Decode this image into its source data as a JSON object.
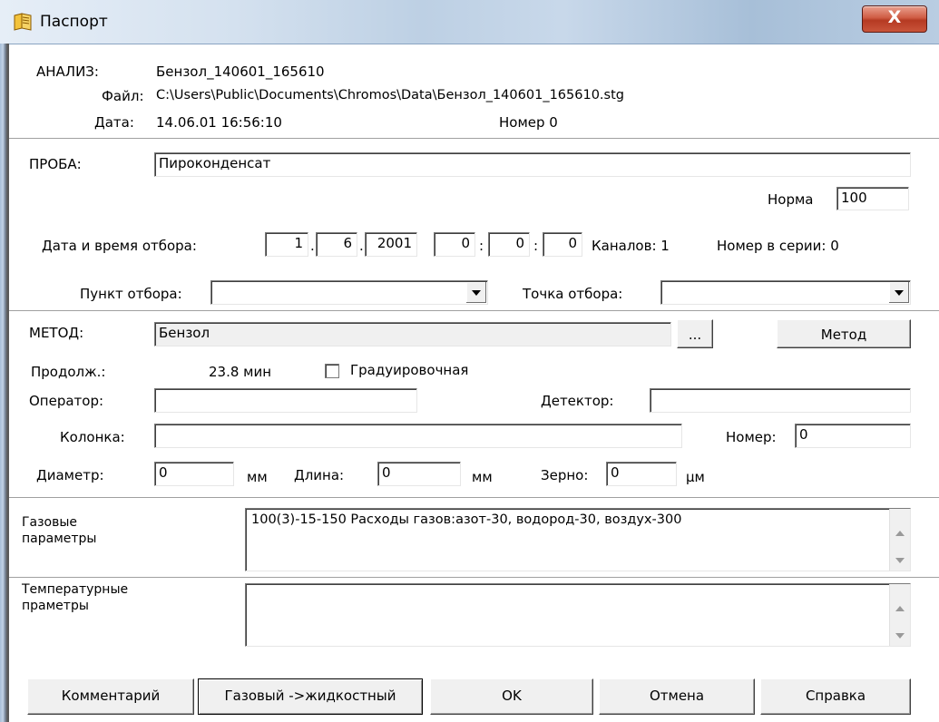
{
  "window": {
    "title": "Паспорт",
    "close_label": "X"
  },
  "analysis": {
    "label": "АНАЛИЗ:",
    "name": "Бензол_140601_165610",
    "file_label": "Файл:",
    "file": "C:\\Users\\Public\\Documents\\Chromos\\Data\\Бензол_140601_165610.stg",
    "date_label": "Дата:",
    "date": "14.06.01  16:56:10",
    "number_label": "Номер 0"
  },
  "sample": {
    "label": "ПРОБА:",
    "value": "Пироконденсат",
    "norm_label": "Норма",
    "norm": "100",
    "datetime_label": "Дата и время отбора:",
    "day": "1",
    "month": "6",
    "year": "2001",
    "hour": "0",
    "minute": "0",
    "second": "0",
    "dot": ".",
    "colon": ":",
    "channels": "Каналов: 1",
    "series_no": "Номер в серии:  0",
    "point_label": "Пункт отбора:",
    "point_value": "",
    "spot_label": "Точка отбора:",
    "spot_value": ""
  },
  "method": {
    "label": "МЕТОД:",
    "value": "Бензол",
    "browse_label": "...",
    "method_button": "Метод",
    "duration_label": "Продолж.:",
    "duration": "23.8 мин",
    "calib_label": "Градуировочная",
    "operator_label": "Оператор:",
    "operator": "",
    "detector_label": "Детектор:",
    "detector": "",
    "column_label": "Колонка:",
    "column": "",
    "number_label": "Номер:",
    "number": "0",
    "diameter_label": "Диаметр:",
    "diameter": "0",
    "mm1": "мм",
    "length_label": "Длина:",
    "length": "0",
    "mm2": "мм",
    "grain_label": "Зерно:",
    "grain": "0",
    "um": "µм"
  },
  "gas": {
    "label_line1": "Газовые",
    "label_line2": "параметры",
    "text": "100(3)-15-150     Расходы газов:азот-30,  водород-30, воздух-300"
  },
  "temp": {
    "label_line1": "Температурные",
    "label_line2": "праметры",
    "text": ""
  },
  "buttons": {
    "comment": "Комментарий",
    "gas_liquid": "Газовый ->жидкостный",
    "ok": "OK",
    "cancel": "Отмена",
    "help": "Справка"
  }
}
